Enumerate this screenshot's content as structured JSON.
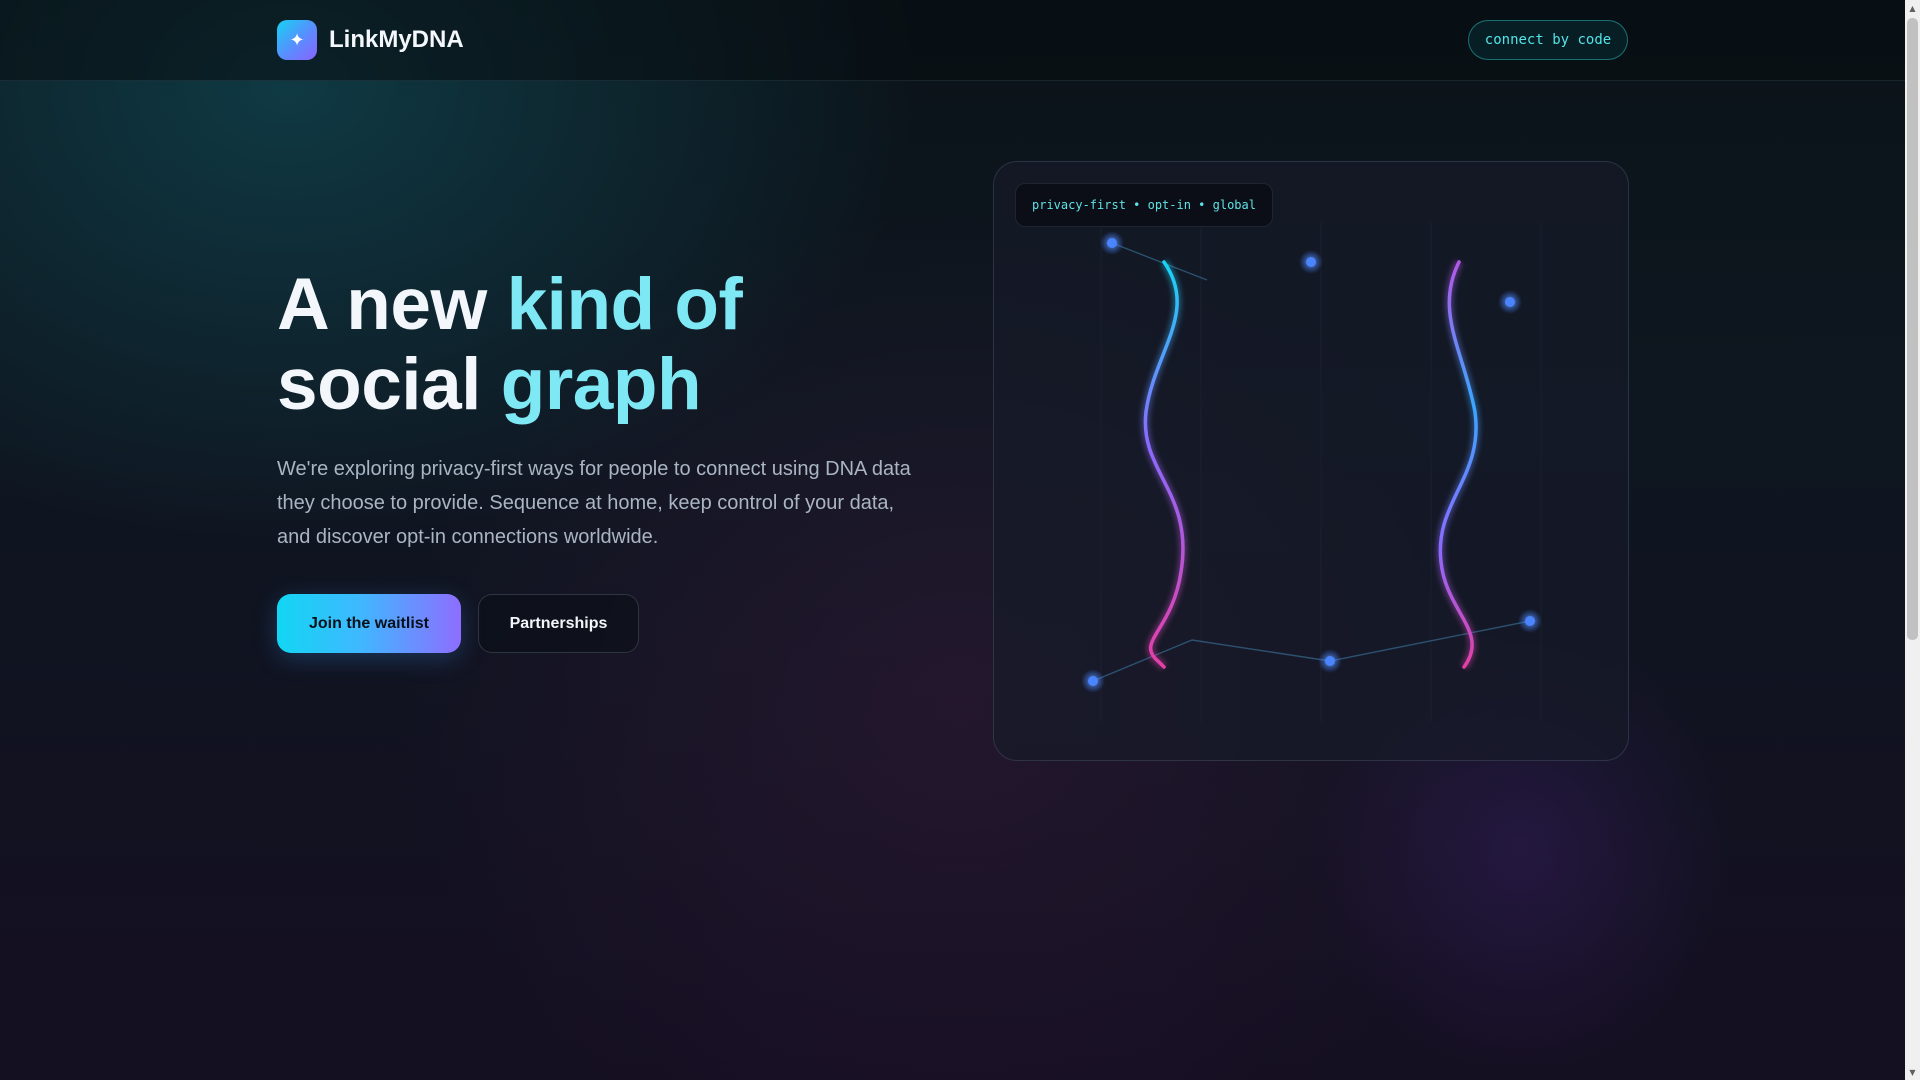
{
  "header": {
    "brand_name": "LinkMyDNA",
    "logo_icon": "dna-sparkle-icon",
    "logo_glyph": "✦",
    "connect_button": "connect by code"
  },
  "hero": {
    "title_line1_white": "A new",
    "title_line1_accent": "kind of",
    "title_line2_white": "social",
    "title_line2_accent": "graph",
    "description": "We're exploring privacy-first ways for people to connect using DNA data they choose to provide. Sequence at home, keep control of your data, and discover opt-in connections worldwide.",
    "primary_button": "Join the waitlist",
    "secondary_button": "Partnerships"
  },
  "visual_card": {
    "badge": "privacy-first • opt-in • global"
  },
  "colors": {
    "accent_cyan": "#12d6f3",
    "accent_violet": "#8e6dff",
    "accent_pink": "#e03fa8",
    "node_blue": "#3d7bff"
  },
  "scrollbar": {
    "up_icon": "▲",
    "down_icon": "▼"
  }
}
